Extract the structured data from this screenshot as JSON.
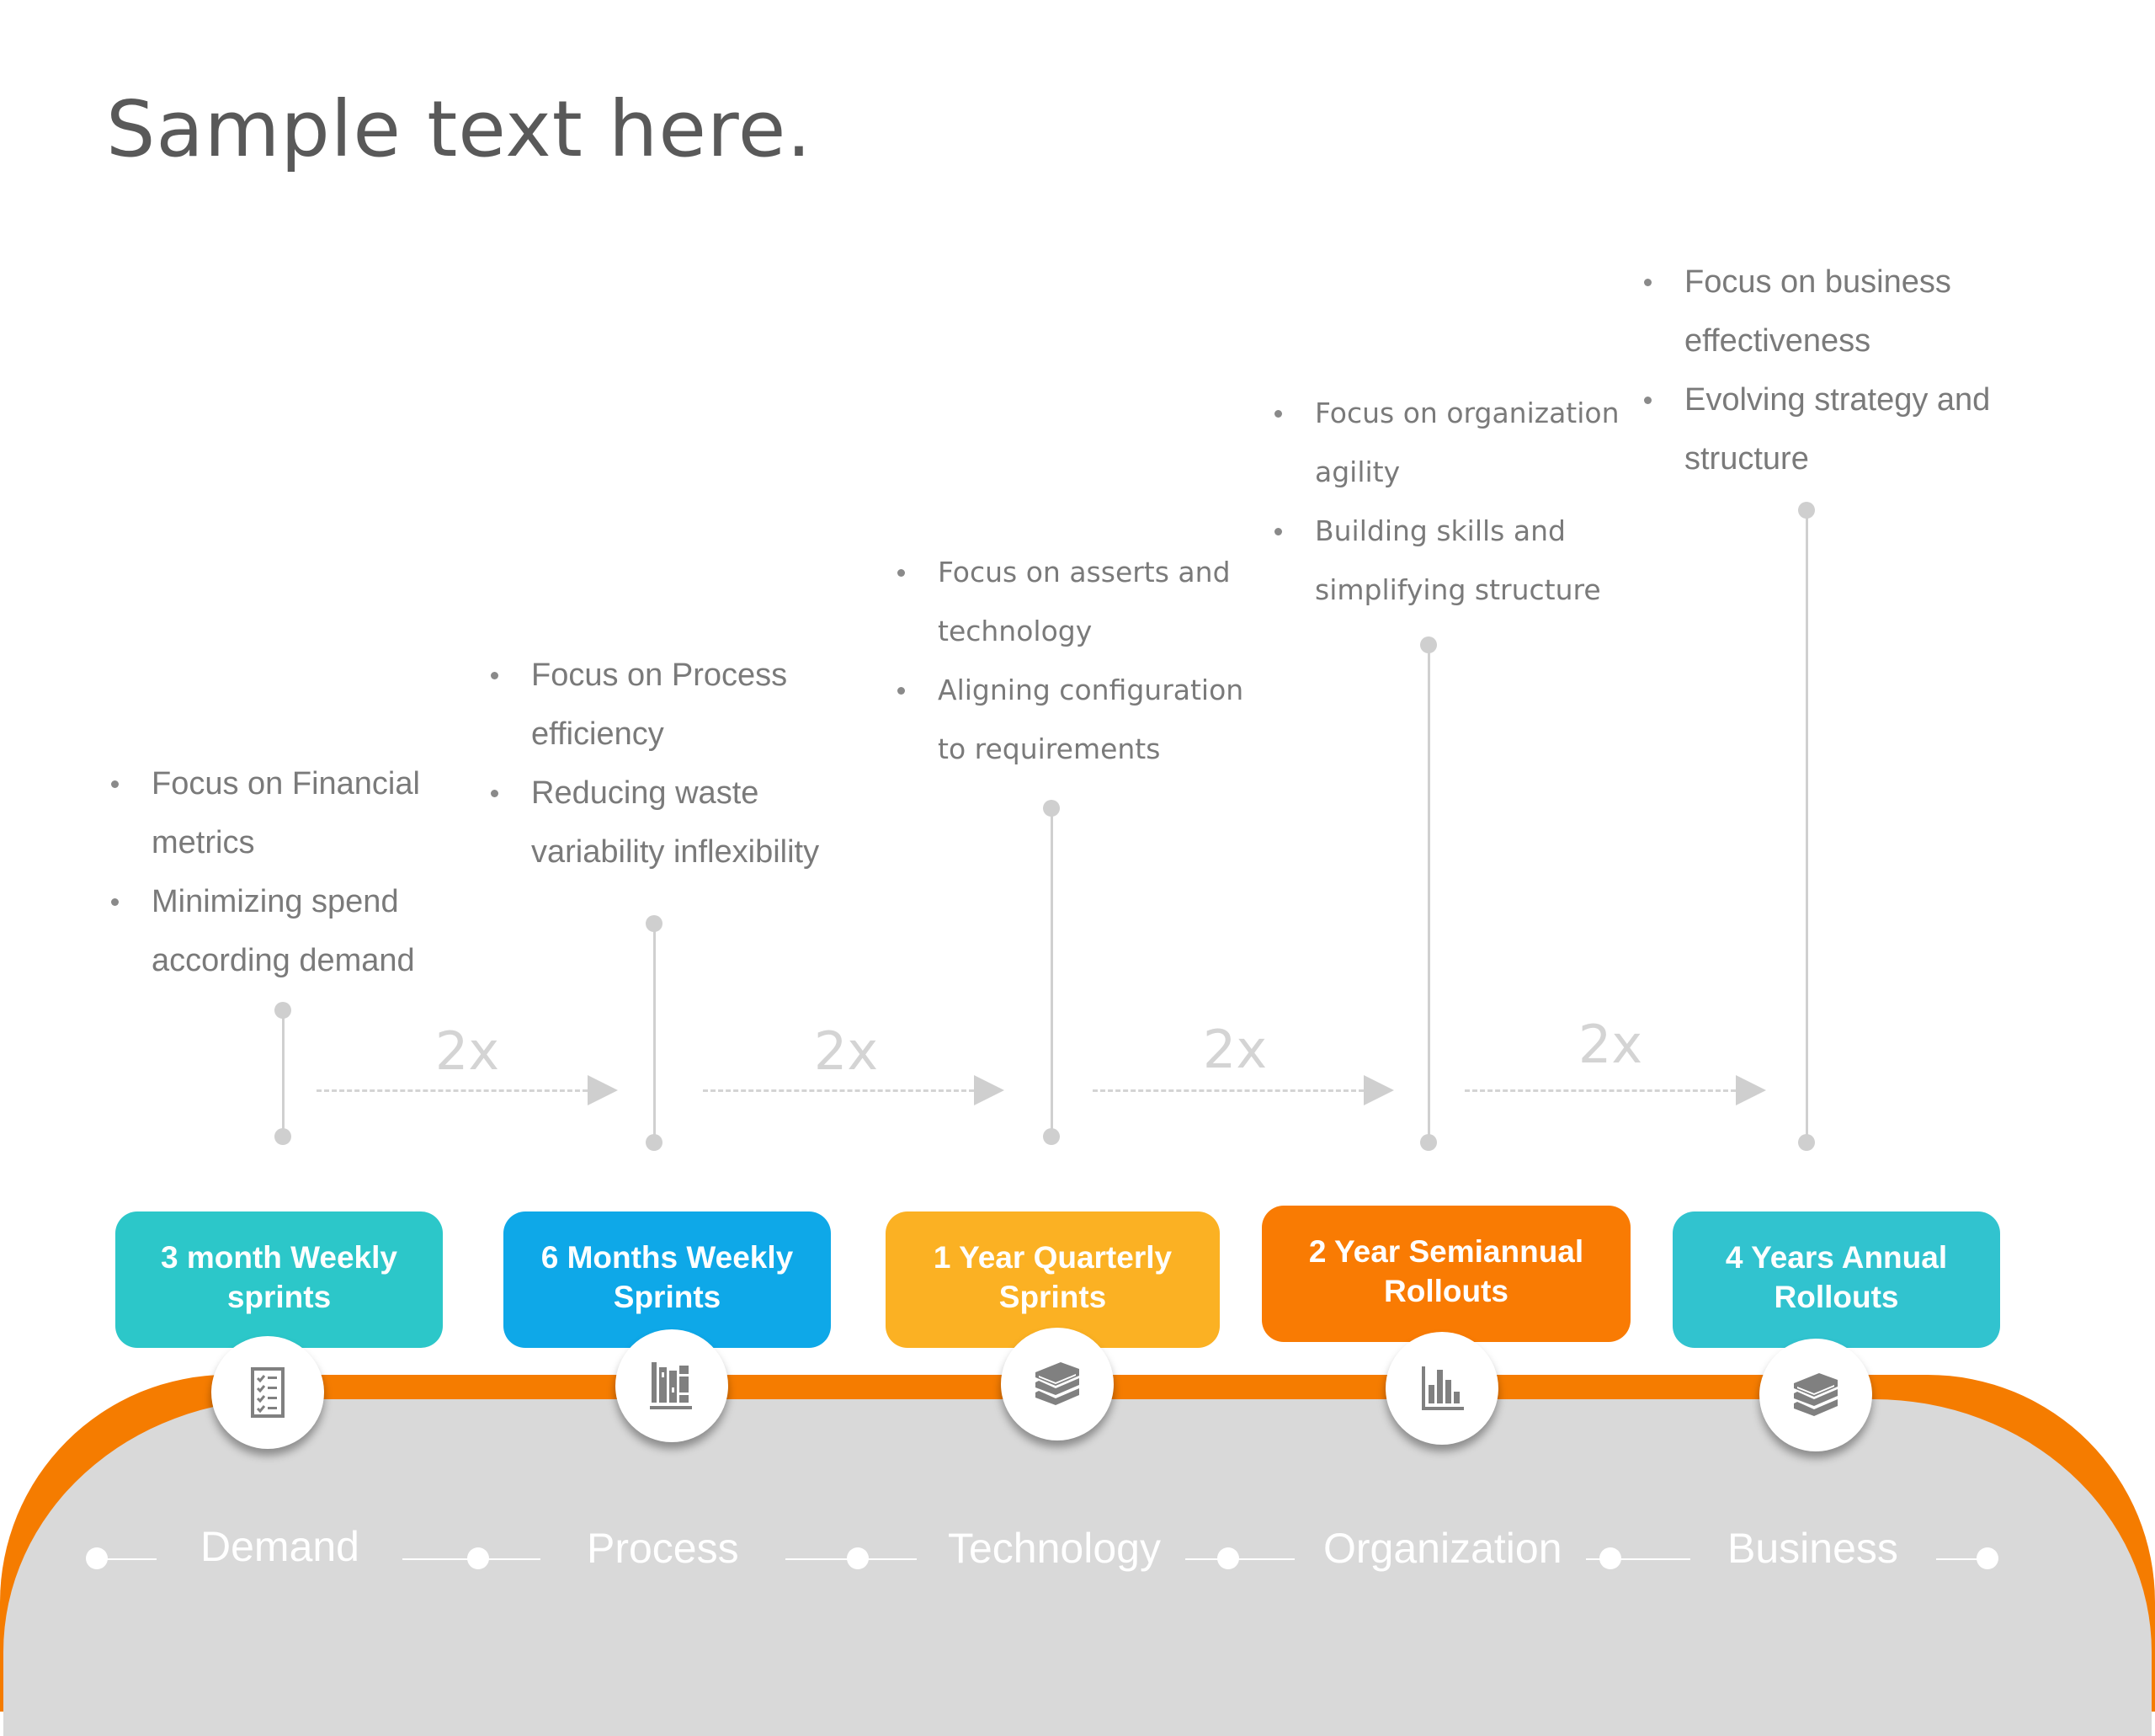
{
  "title": "Sample text here.",
  "multiplier_label": "2x",
  "columns": [
    {
      "bullets": [
        "Focus on Financial metrics",
        "Minimizing spend according demand"
      ],
      "box_label": "3 month Weekly sprints",
      "box_color": "#2cc7c9",
      "icon": "checklist-icon",
      "category": "Demand"
    },
    {
      "bullets": [
        "Focus on Process efficiency",
        "Reducing waste variability inflexibility"
      ],
      "box_label": "6 Months Weekly Sprints",
      "box_color": "#0ea8e8",
      "icon": "library-books-icon",
      "category": "Process"
    },
    {
      "bullets": [
        "Focus on asserts and technology",
        "Aligning configuration to requirements"
      ],
      "box_label": "1 Year Quarterly Sprints",
      "box_color": "#fbb123",
      "icon": "book-stack-icon",
      "category": "Technology"
    },
    {
      "bullets": [
        "Focus on organization agility",
        "Building skills and simplifying structure"
      ],
      "box_label": "2 Year Semiannual Rollouts",
      "box_color": "#f97b03",
      "icon": "bar-chart-icon",
      "category": "Organization"
    },
    {
      "bullets": [
        "Focus on business effectiveness",
        "Evolving strategy and structure"
      ],
      "box_label": "4 Years Annual Rollouts",
      "box_color": "#31c3cf",
      "icon": "book-stack-icon",
      "category": "Business"
    }
  ],
  "colors": {
    "band_orange": "#f57c00",
    "band_grey": "#d9d9d9",
    "text_grey": "#7a7a7a",
    "icon_grey": "#808080"
  }
}
